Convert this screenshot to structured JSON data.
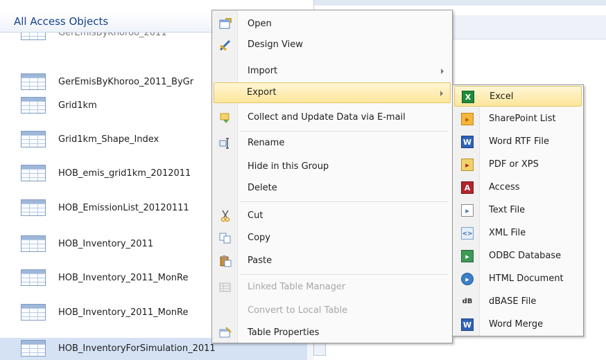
{
  "nav": {
    "title": "All Access Objects",
    "partial_item": "GerEmisByKhoroo_2011",
    "items": [
      "GerEmisByKhoroo_2011_ByGr",
      "Grid1km",
      "Grid1km_Shape_Index",
      "HOB_emis_grid1km_2012011",
      "HOB_EmissionList_20120111",
      "HOB_Inventory_2011",
      "HOB_Inventory_2011_MonRe",
      "HOB_Inventory_2011_MonRe",
      "HOB_InventoryForSimulation_2011"
    ]
  },
  "context_menu": {
    "open": "Open",
    "design_view": "Design View",
    "import": "Import",
    "export": "Export",
    "collect": "Collect and Update Data via E-mail",
    "rename": "Rename",
    "hide": "Hide in this Group",
    "delete": "Delete",
    "cut": "Cut",
    "copy": "Copy",
    "paste": "Paste",
    "linked_table_manager": "Linked Table Manager",
    "convert_local": "Convert to Local Table",
    "table_properties": "Table Properties"
  },
  "export_submenu": {
    "excel": "Excel",
    "sharepoint": "SharePoint List",
    "word_rtf": "Word RTF File",
    "pdf_xps": "PDF or XPS",
    "access": "Access",
    "text_file": "Text File",
    "xml_file": "XML File",
    "odbc": "ODBC Database",
    "html": "HTML Document",
    "dbase": "dBASE File",
    "word_merge": "Word Merge"
  },
  "colors": {
    "highlight": "#fde69a",
    "nav_title": "#15428b",
    "selected_row": "#d5e2f4"
  }
}
